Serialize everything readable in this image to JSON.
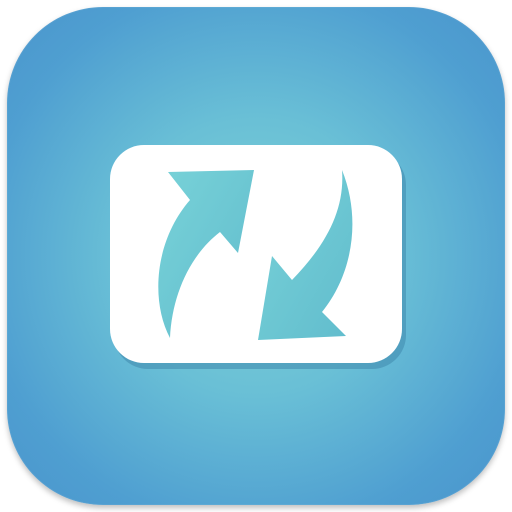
{
  "icon": {
    "symbol": "sync-arrows-icon",
    "colors": {
      "background_center": "#7fd3d8",
      "background_edge": "#4a95cc",
      "card": "#ffffff",
      "arrow": "#6fcad3",
      "card_shadow": "#3f88ad"
    }
  }
}
